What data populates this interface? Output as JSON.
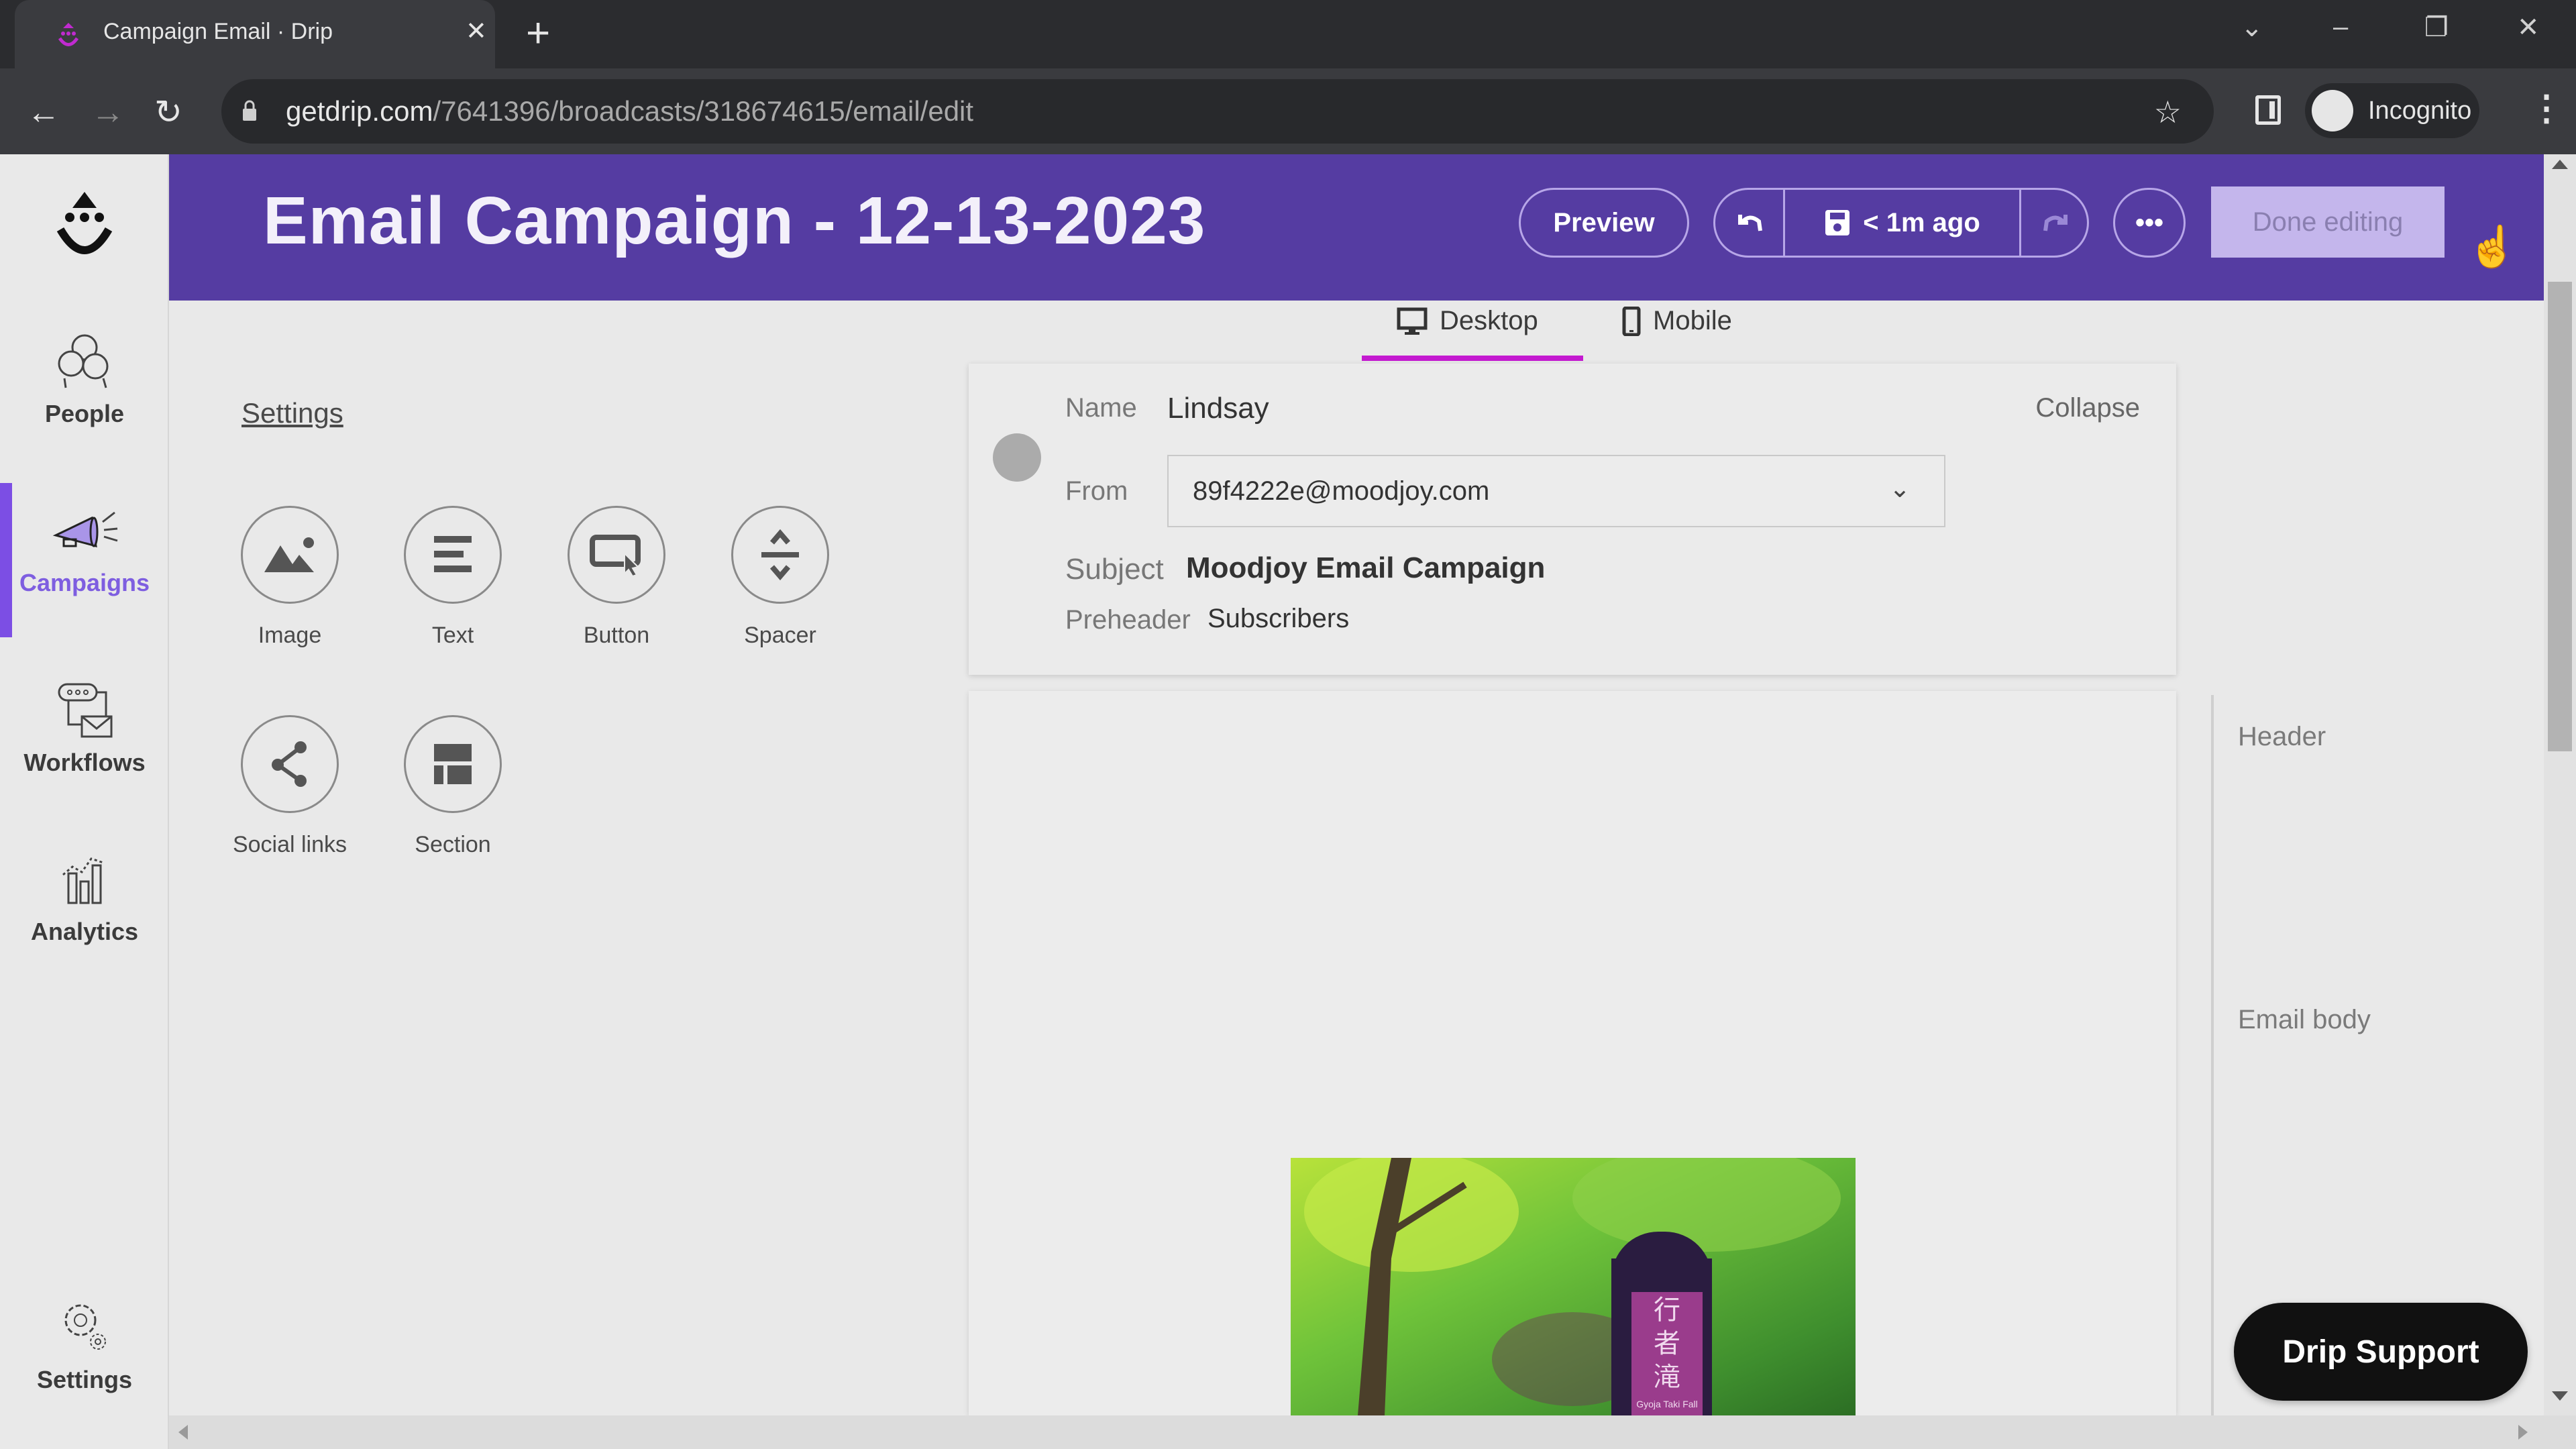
{
  "browser": {
    "tab_title": "Campaign Email · Drip",
    "url_host": "getdrip.com",
    "url_path": "/7641396/broadcasts/318674615/email/edit",
    "profile_label": "Incognito",
    "icons": {
      "back": "arrow-left-icon",
      "forward": "arrow-right-icon",
      "reload": "reload-icon",
      "lock": "lock-icon",
      "bookmark": "star-icon",
      "side_panel": "side-panel-icon",
      "menu": "kebab-menu-icon"
    },
    "window_controls": {
      "tab_search": "⌄",
      "minimize": "–",
      "restore": "❐",
      "close": "✕"
    }
  },
  "sidenav": {
    "items": [
      {
        "label": "People",
        "icon": "people-icon"
      },
      {
        "label": "Campaigns",
        "icon": "megaphone-icon",
        "active": true
      },
      {
        "label": "Workflows",
        "icon": "workflow-icon"
      },
      {
        "label": "Analytics",
        "icon": "analytics-icon"
      },
      {
        "label": "Settings",
        "icon": "gear-icon"
      }
    ]
  },
  "header": {
    "title": "Email Campaign - 12-13-2023",
    "preview_label": "Preview",
    "save_status": "< 1m ago",
    "done_label": "Done editing",
    "more_label": "•••"
  },
  "device_tabs": [
    {
      "label": "Desktop",
      "active": true
    },
    {
      "label": "Mobile",
      "active": false
    }
  ],
  "palette": {
    "settings_label": "Settings",
    "blocks": [
      {
        "label": "Image",
        "icon": "image-icon"
      },
      {
        "label": "Text",
        "icon": "text-icon"
      },
      {
        "label": "Button",
        "icon": "button-icon"
      },
      {
        "label": "Spacer",
        "icon": "spacer-icon"
      },
      {
        "label": "Social links",
        "icon": "share-icon"
      },
      {
        "label": "Section",
        "icon": "section-icon"
      }
    ]
  },
  "email_settings": {
    "name_label": "Name",
    "name_value": "Lindsay",
    "from_label": "From",
    "from_value": "89f4222e@moodjoy.com",
    "subject_label": "Subject",
    "subject_value": "Moodjoy Email Campaign",
    "preheader_label": "Preheader",
    "preheader_value": "Subscribers",
    "collapse_label": "Collapse"
  },
  "email_body": {
    "image_sign_text": "行者滝",
    "image_caption": "Gyoja Taki Fall"
  },
  "outline": {
    "items": [
      "Header",
      "Email body"
    ]
  },
  "support": {
    "label": "Drip Support"
  },
  "colors": {
    "brand_purple": "#553ca2",
    "active_nav": "#7e5ee0",
    "tab_underline": "#c41ad0",
    "done_button_bg": "#c4b6ec"
  }
}
